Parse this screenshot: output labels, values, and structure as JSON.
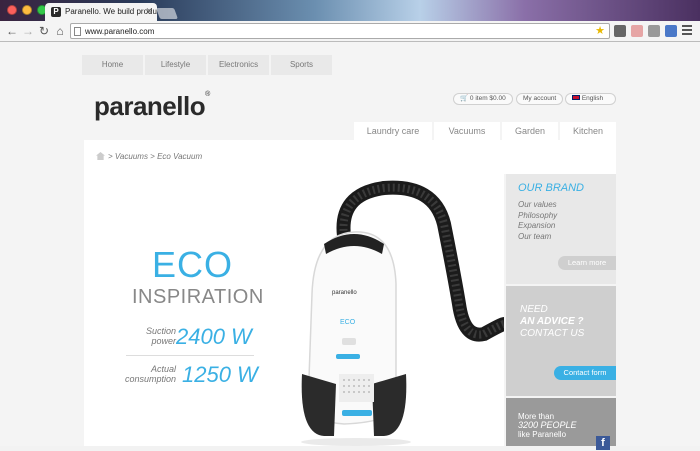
{
  "browser": {
    "tab_title": "Paranello. We build produ",
    "favicon_letter": "P",
    "url": "www.paranello.com"
  },
  "topnav": [
    "Home",
    "Lifestyle",
    "Electronics",
    "Sports"
  ],
  "header": {
    "logo": "paranello",
    "cart": "0 item $0.00",
    "account": "My account",
    "language": "English"
  },
  "categories": [
    "Laundry care",
    "Vacuums",
    "Garden",
    "Kitchen"
  ],
  "breadcrumb": "> Vacuums > Eco Vacuum",
  "hero": {
    "eco": "ECO",
    "inspiration": "INSPIRATION",
    "suction_label_1": "Suction",
    "suction_label_2": "power",
    "suction_value": "2400 W",
    "consumption_label_1": "Actual",
    "consumption_label_2": "consumption",
    "consumption_value": "1250 W",
    "product_brand": "paranello",
    "product_eco": "ECO"
  },
  "sidebar": {
    "brand_title": "OUR BRAND",
    "brand_links": [
      "Our values",
      "Philosophy",
      "Expansion",
      "Our team"
    ],
    "learn_more": "Learn more",
    "advice_1": "NEED",
    "advice_2": "AN ADVICE ?",
    "advice_3": "CONTACT US",
    "contact_button": "Contact form",
    "fans_1": "More than",
    "fans_2": "3200 PEOPLE",
    "fans_3": "like Paranello"
  },
  "colors": {
    "accent": "#3ab0e4",
    "facebook": "#3b5998"
  }
}
